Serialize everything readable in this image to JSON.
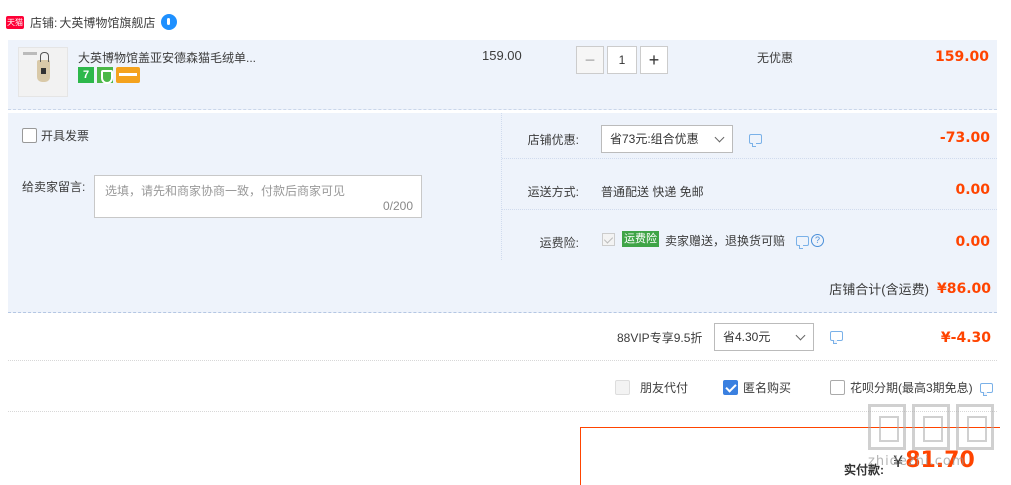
{
  "shop": {
    "badge": "天猫",
    "label": "店铺:",
    "name": "大英博物馆旗舰店"
  },
  "item": {
    "title": "大英博物馆盖亚安德森猫毛绒单...",
    "badge_7": "7",
    "unit_price": "159.00",
    "quantity": "1",
    "minus": "−",
    "plus": "+",
    "discount": "无优惠",
    "total": "159.00"
  },
  "options": {
    "invoice_label": "开具发票",
    "message_label": "给卖家留言:",
    "message_placeholder": "选填，请先和商家协商一致，付款后商家可见",
    "message_count": "0/200",
    "shop_coupon_label": "店铺优惠:",
    "shop_coupon_value": "省73元:组合优惠",
    "shop_coupon_amount": "-73.00",
    "shipping_label": "运送方式:",
    "shipping_value": "普通配送 快递 免邮",
    "shipping_amount": "0.00",
    "insurance_label": "运费险:",
    "insurance_badge": "运费险",
    "insurance_text": "卖家赠送，退换货可赔",
    "insurance_amount": "0.00",
    "help_glyph": "?"
  },
  "shop_total": {
    "label": "店铺合计(含运费)",
    "amount": "¥86.00"
  },
  "vip": {
    "label": "88VIP专享9.5折",
    "select_value": "省4.30元",
    "amount": "¥-4.30"
  },
  "pay_options": [
    {
      "label": "朋友代付",
      "state": "disabled"
    },
    {
      "label": "匿名购买",
      "state": "checked"
    },
    {
      "label": "花呗分期(最高3期免息)",
      "state": "unchecked"
    }
  ],
  "final": {
    "label": "实付款:",
    "currency": "¥",
    "amount": "81.70"
  },
  "watermark": {
    "text": "zhidezhi.com"
  },
  "colors": {
    "accent": "#ff4400",
    "panel_bg": "#eef3fb",
    "check_blue": "#3a80e0",
    "insurance_green": "#3fa447"
  }
}
